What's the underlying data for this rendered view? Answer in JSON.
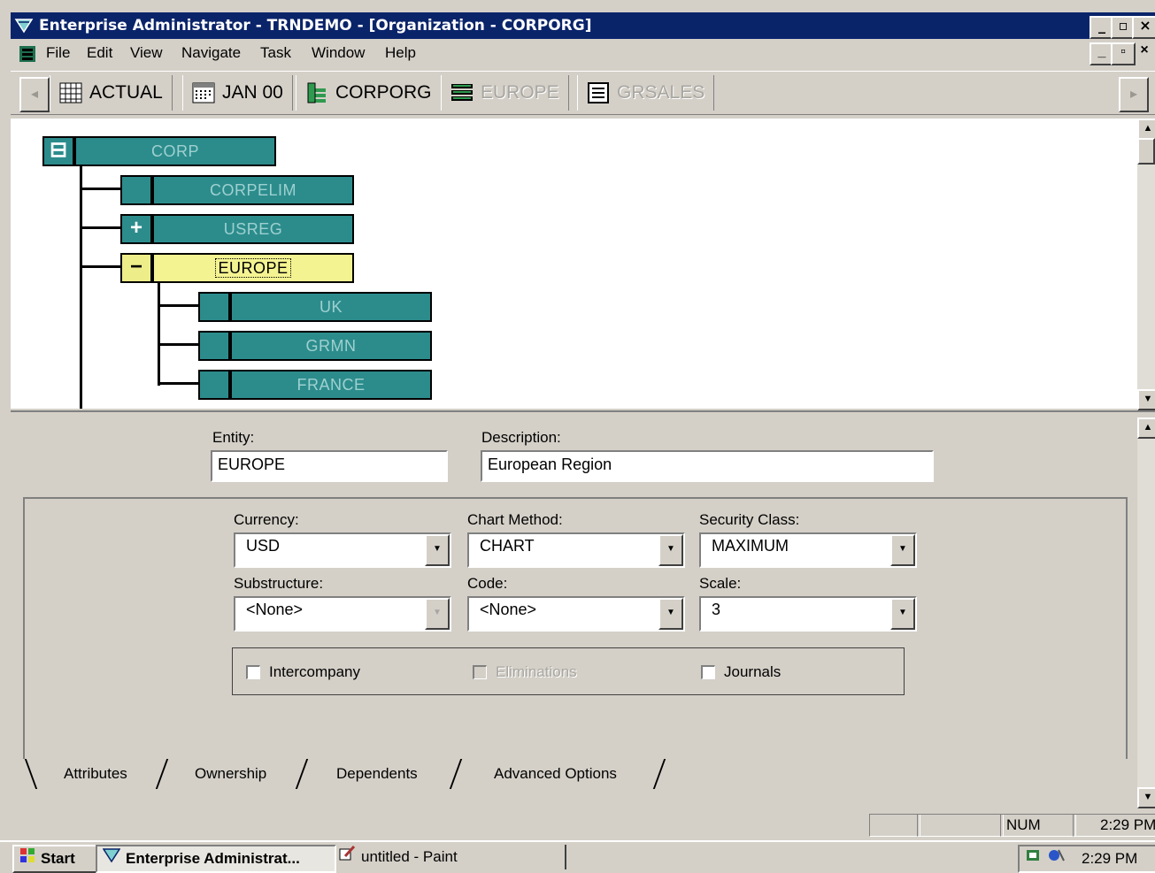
{
  "window": {
    "title": "Enterprise Administrator - TRNDEMO - [Organization - CORPORG]"
  },
  "menu": {
    "items": [
      {
        "label": "File"
      },
      {
        "label": "Edit"
      },
      {
        "label": "View"
      },
      {
        "label": "Navigate"
      },
      {
        "label": "Task"
      },
      {
        "label": "Window"
      },
      {
        "label": "Help"
      }
    ]
  },
  "toolbar": {
    "crumbs": [
      {
        "label": "ACTUAL",
        "icon": "grid-icon",
        "enabled": true
      },
      {
        "label": "JAN 00",
        "icon": "calendar-icon",
        "enabled": true
      },
      {
        "label": "CORPORG",
        "icon": "org-icon",
        "enabled": true
      },
      {
        "label": "EUROPE",
        "icon": "list-icon",
        "enabled": false
      },
      {
        "label": "GRSALES",
        "icon": "account-icon",
        "enabled": false
      }
    ]
  },
  "tree": {
    "root": {
      "label": "CORP",
      "expander": "⊟"
    },
    "children": [
      {
        "label": "CORPELIM",
        "expander": ""
      },
      {
        "label": "USREG",
        "expander": "+"
      },
      {
        "label": "EUROPE",
        "expander": "−",
        "selected": true
      }
    ],
    "grandchildren": [
      {
        "label": "UK"
      },
      {
        "label": "GRMN"
      },
      {
        "label": "FRANCE"
      }
    ]
  },
  "detail": {
    "entity_label": "Entity:",
    "entity_value": "EUROPE",
    "description_label": "Description:",
    "description_value": "European Region",
    "currency_label": "Currency:",
    "currency_value": "USD",
    "chart_method_label": "Chart Method:",
    "chart_method_value": "CHART",
    "security_class_label": "Security Class:",
    "security_class_value": "MAXIMUM",
    "substructure_label": "Substructure:",
    "substructure_value": "<None>",
    "code_label": "Code:",
    "code_value": "<None>",
    "scale_label": "Scale:",
    "scale_value": "3",
    "intercompany_label": "Intercompany",
    "eliminations_label": "Eliminations",
    "journals_label": "Journals"
  },
  "tabs": [
    {
      "label": "Attributes",
      "active": true
    },
    {
      "label": "Ownership"
    },
    {
      "label": "Dependents"
    },
    {
      "label": "Advanced Options"
    }
  ],
  "statusbar": {
    "num": "NUM",
    "time": "2:29 PM"
  },
  "taskbar": {
    "start": "Start",
    "tasks": [
      {
        "label": "Enterprise Administrat..."
      },
      {
        "label": "untitled - Paint"
      }
    ],
    "clock": "2:29 PM"
  },
  "colors": {
    "titlebar": "#0a246a",
    "node_fill": "#2c8c8c",
    "selected_node": "#f4f392",
    "chrome": "#d4d0c8"
  }
}
